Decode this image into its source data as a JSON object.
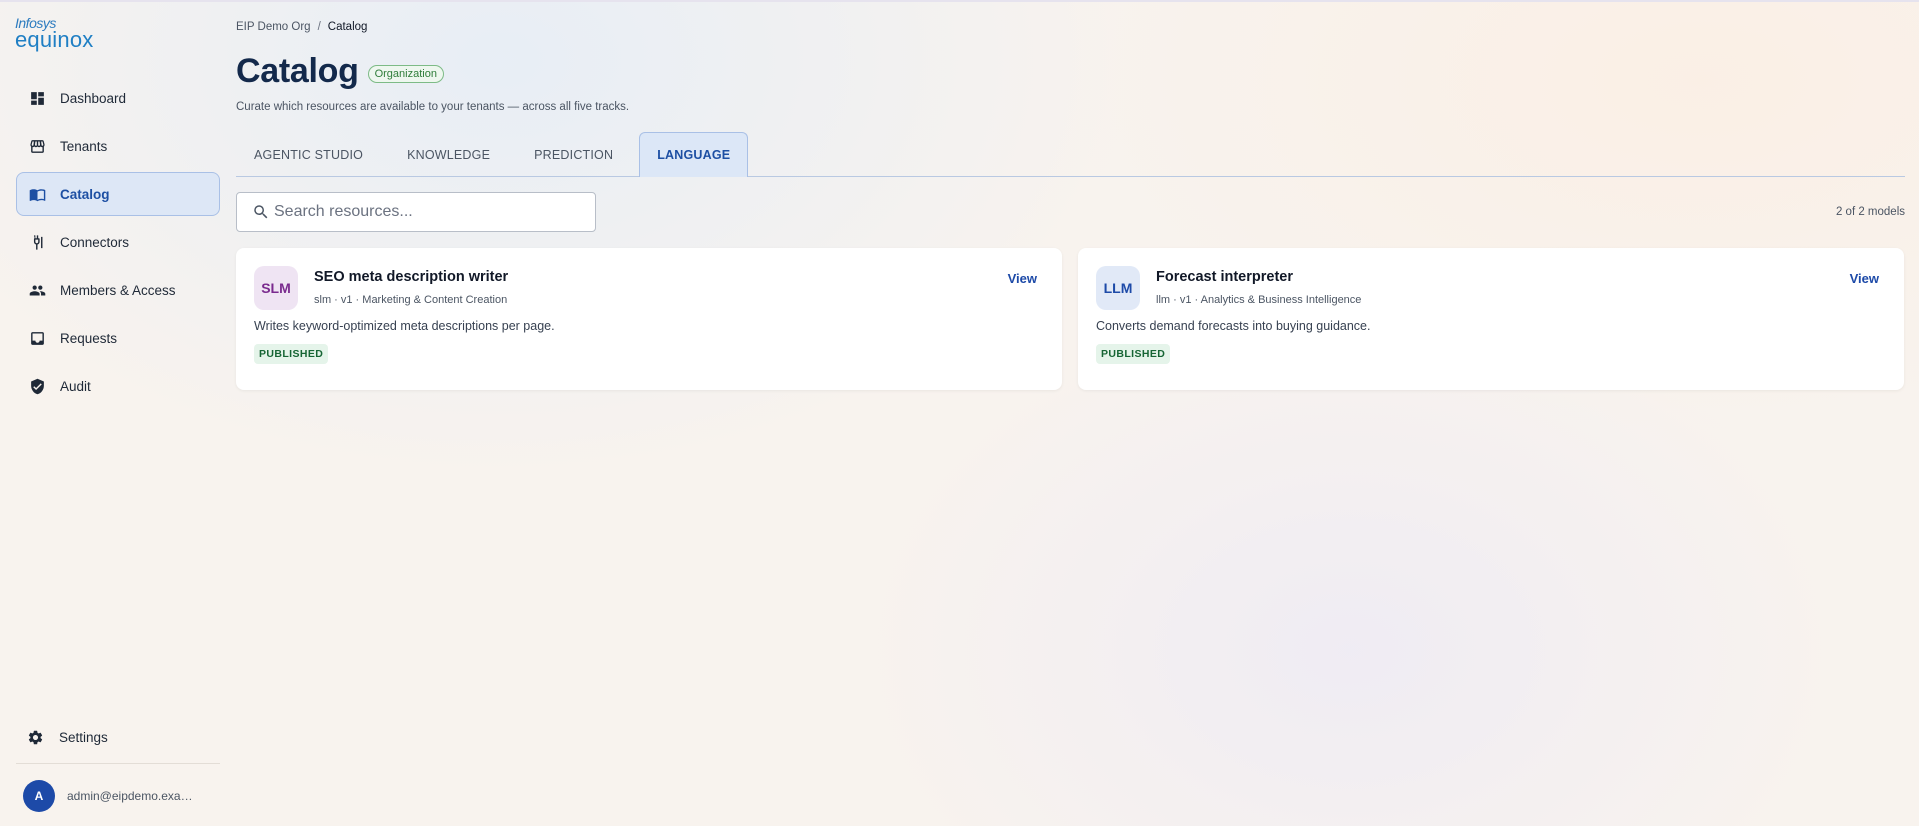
{
  "brand": {
    "line1": "Infosys",
    "line2": "equinox"
  },
  "sidebar": {
    "items": [
      {
        "label": "Dashboard",
        "icon": "dashboard-icon"
      },
      {
        "label": "Tenants",
        "icon": "storefront-icon"
      },
      {
        "label": "Catalog",
        "icon": "catalog-book-icon",
        "active": true
      },
      {
        "label": "Connectors",
        "icon": "connector-plug-icon"
      },
      {
        "label": "Members & Access",
        "icon": "people-icon"
      },
      {
        "label": "Requests",
        "icon": "inbox-icon"
      },
      {
        "label": "Audit",
        "icon": "shield-check-icon"
      }
    ],
    "settings_label": "Settings",
    "user": {
      "initial": "A",
      "email": "admin@eipdemo.example.com"
    }
  },
  "breadcrumb": {
    "parent": "EIP Demo Org",
    "separator": "/",
    "current": "Catalog"
  },
  "page": {
    "title": "Catalog",
    "badge": "Organization",
    "subtitle": "Curate which resources are available to your tenants — across all five tracks."
  },
  "tabs": [
    {
      "label": "AGENTIC STUDIO"
    },
    {
      "label": "KNOWLEDGE"
    },
    {
      "label": "PREDICTION"
    },
    {
      "label": "LANGUAGE",
      "active": true
    }
  ],
  "search": {
    "placeholder": "Search resources...",
    "value": ""
  },
  "count_text": "2 of 2 models",
  "cards": [
    {
      "abbr": "SLM",
      "name": "SEO meta description writer",
      "meta": "slm · v1 · Marketing & Content Creation",
      "description": "Writes keyword-optimized meta descriptions per page.",
      "status": "PUBLISHED",
      "action": "View"
    },
    {
      "abbr": "LLM",
      "name": "Forecast interpreter",
      "meta": "llm · v1 · Analytics & Business Intelligence",
      "description": "Converts demand forecasts into buying guidance.",
      "status": "PUBLISHED",
      "action": "View"
    }
  ],
  "colors": {
    "accent": "#1d4fa3",
    "active_bg": "#dde7f6",
    "published_bg": "#e5f4ea",
    "published_text": "#166534",
    "org_badge": "#2f7d3a"
  }
}
